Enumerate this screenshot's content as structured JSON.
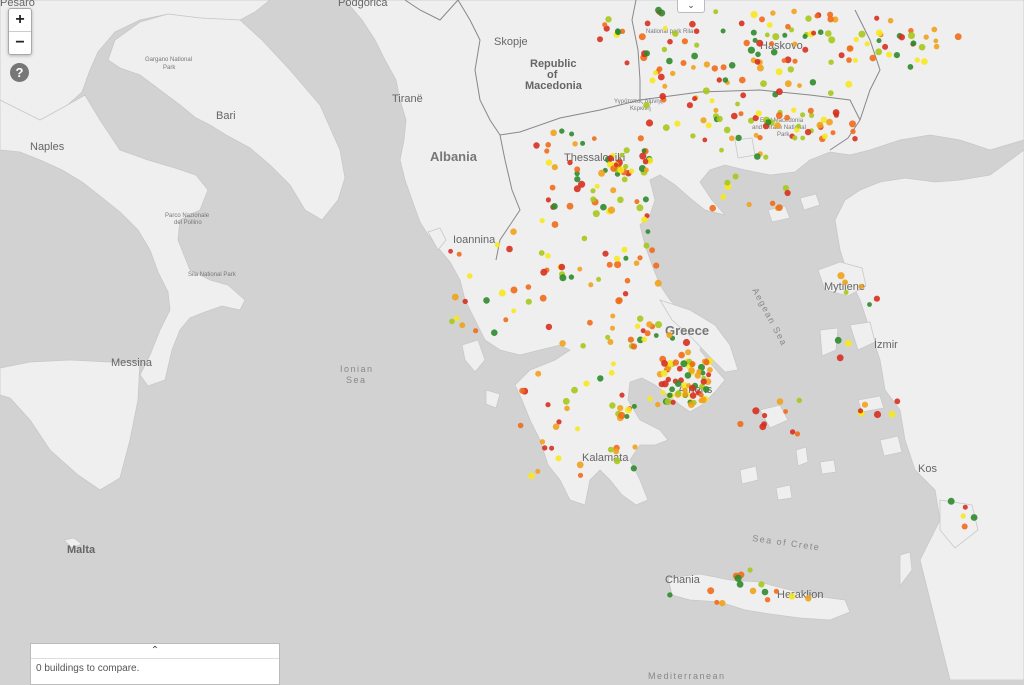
{
  "controls": {
    "zoom_in": "+",
    "zoom_out": "−",
    "help": "?",
    "top_toggle": "⌄",
    "compare_toggle": "⌃",
    "compare_text": "0 buildings to compare."
  },
  "labels": {
    "podgorica": "Podgorica",
    "pesaro": "Pesaro",
    "skopje": "Skopje",
    "macedonia_1": "Republic",
    "macedonia_2": "of",
    "macedonia_3": "Macedonia",
    "rila": "National park Rila",
    "haskovo": "Haskovo",
    "gargano_1": "Gargano National",
    "gargano_2": "Park",
    "bari": "Bari",
    "tirane": "Tiranë",
    "kerkini_1": "Υγρότοπος Λίμνης",
    "kerkini_2": "Κερκίνη",
    "emthrace_1": "East Macedonia",
    "emthrace_2": "and Thrace National",
    "emthrace_3": "Park",
    "naples": "Naples",
    "albania": "Albania",
    "thessaloniki": "Thessaloniki",
    "pollino_1": "Parco Nazionale",
    "pollino_2": "del Pollino",
    "ioannina": "Ioannina",
    "sila": "Sila National Park",
    "aegean": "Aegean Sea",
    "mytilene": "Mytilene",
    "greece": "Greece",
    "izmir": "İzmir",
    "messina": "Messina",
    "ionian_1": "Ionian",
    "ionian_2": "Sea",
    "athens": "Athens",
    "kalamata": "Kalamata",
    "kos": "Kos",
    "malta": "Malta",
    "sea_of_crete": "Sea of Crete",
    "chania": "Chania",
    "heraklion": "Heraklion",
    "mediterranean": "Mediterranean"
  },
  "marker_colors": {
    "red": "#d7301f",
    "orange": "#ef6c1a",
    "amber": "#f0a21c",
    "yellow": "#f7e81e",
    "lime": "#a6c81a",
    "green": "#2e8b2e"
  }
}
